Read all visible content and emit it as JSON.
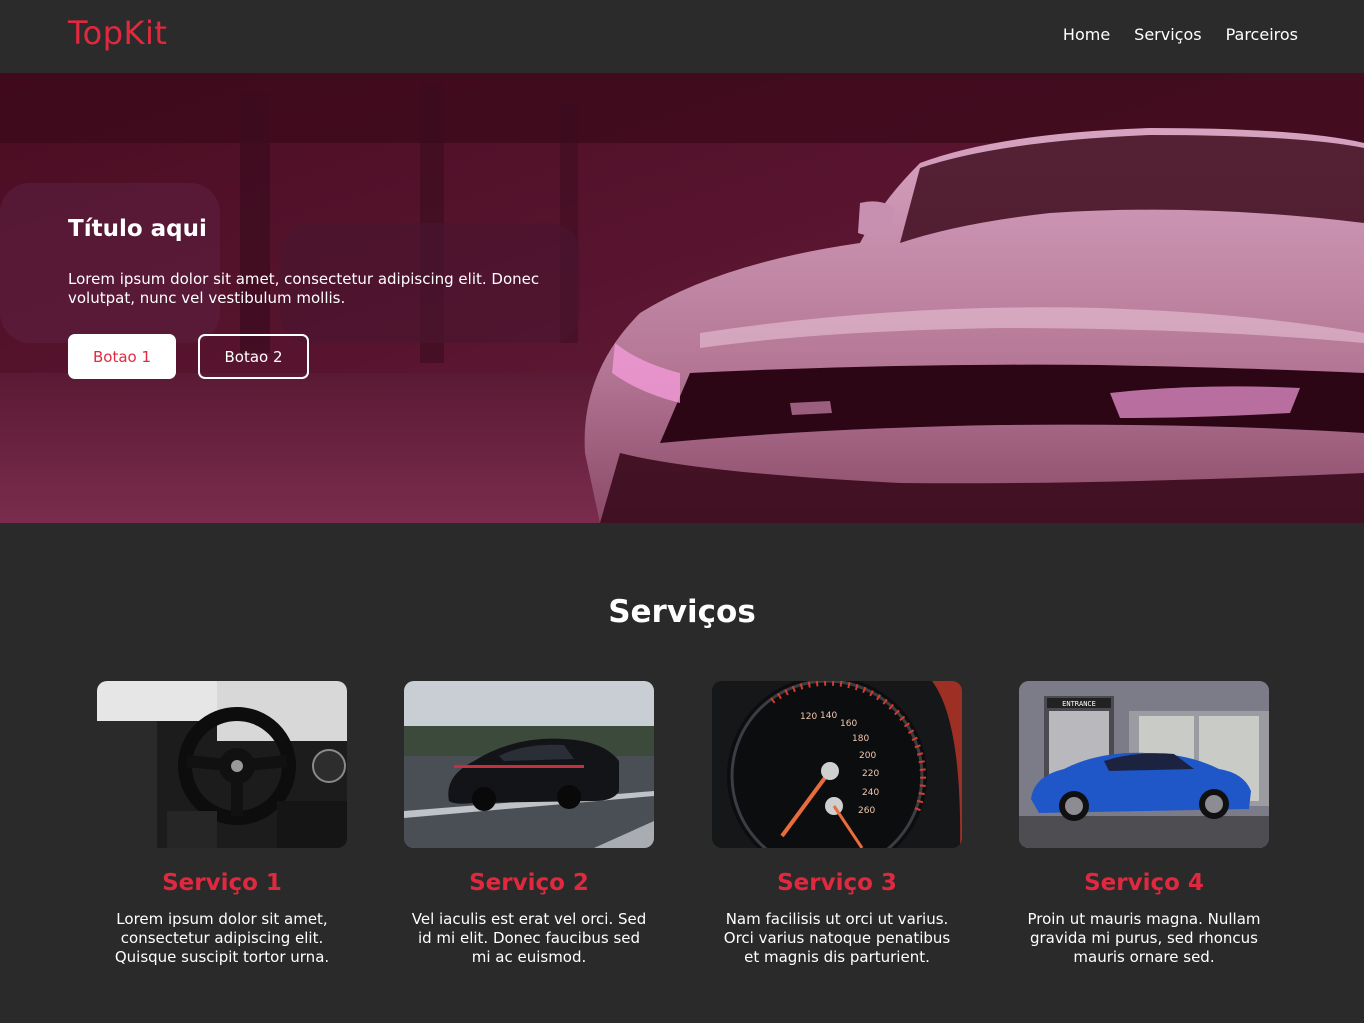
{
  "header": {
    "logo": "TopKit",
    "nav": [
      {
        "label": "Home"
      },
      {
        "label": "Serviços"
      },
      {
        "label": "Parceiros"
      }
    ]
  },
  "hero": {
    "title": "Título aqui",
    "text": "Lorem ipsum dolor sit amet, consectetur adipiscing elit. Donec volutpat, nunc vel vestibulum mollis.",
    "button_primary": "Botao 1",
    "button_secondary": "Botao 2"
  },
  "services": {
    "title": "Serviços",
    "cards": [
      {
        "title": "Serviço 1",
        "text": "Lorem ipsum dolor sit amet, consectetur adipiscing elit. Quisque suscipit tortor urna."
      },
      {
        "title": "Serviço 2",
        "text": "Vel iaculis est erat vel orci. Sed id mi elit. Donec faucibus sed mi ac euismod."
      },
      {
        "title": "Serviço 3",
        "text": "Nam facilisis ut orci ut varius. Orci varius natoque penatibus et magnis dis parturient."
      },
      {
        "title": "Serviço 4",
        "text": "Proin ut mauris magna. Nullam gravida mi purus, sed rhoncus mauris ornare sed."
      }
    ],
    "speedometer_labels": [
      "120",
      "140",
      "160",
      "180",
      "200",
      "220",
      "240",
      "260"
    ],
    "entrance_sign": "ENTRANCE"
  },
  "colors": {
    "accent": "#e0293f",
    "background": "#2a2a2a",
    "hero_tint": "#6a1a3a"
  }
}
